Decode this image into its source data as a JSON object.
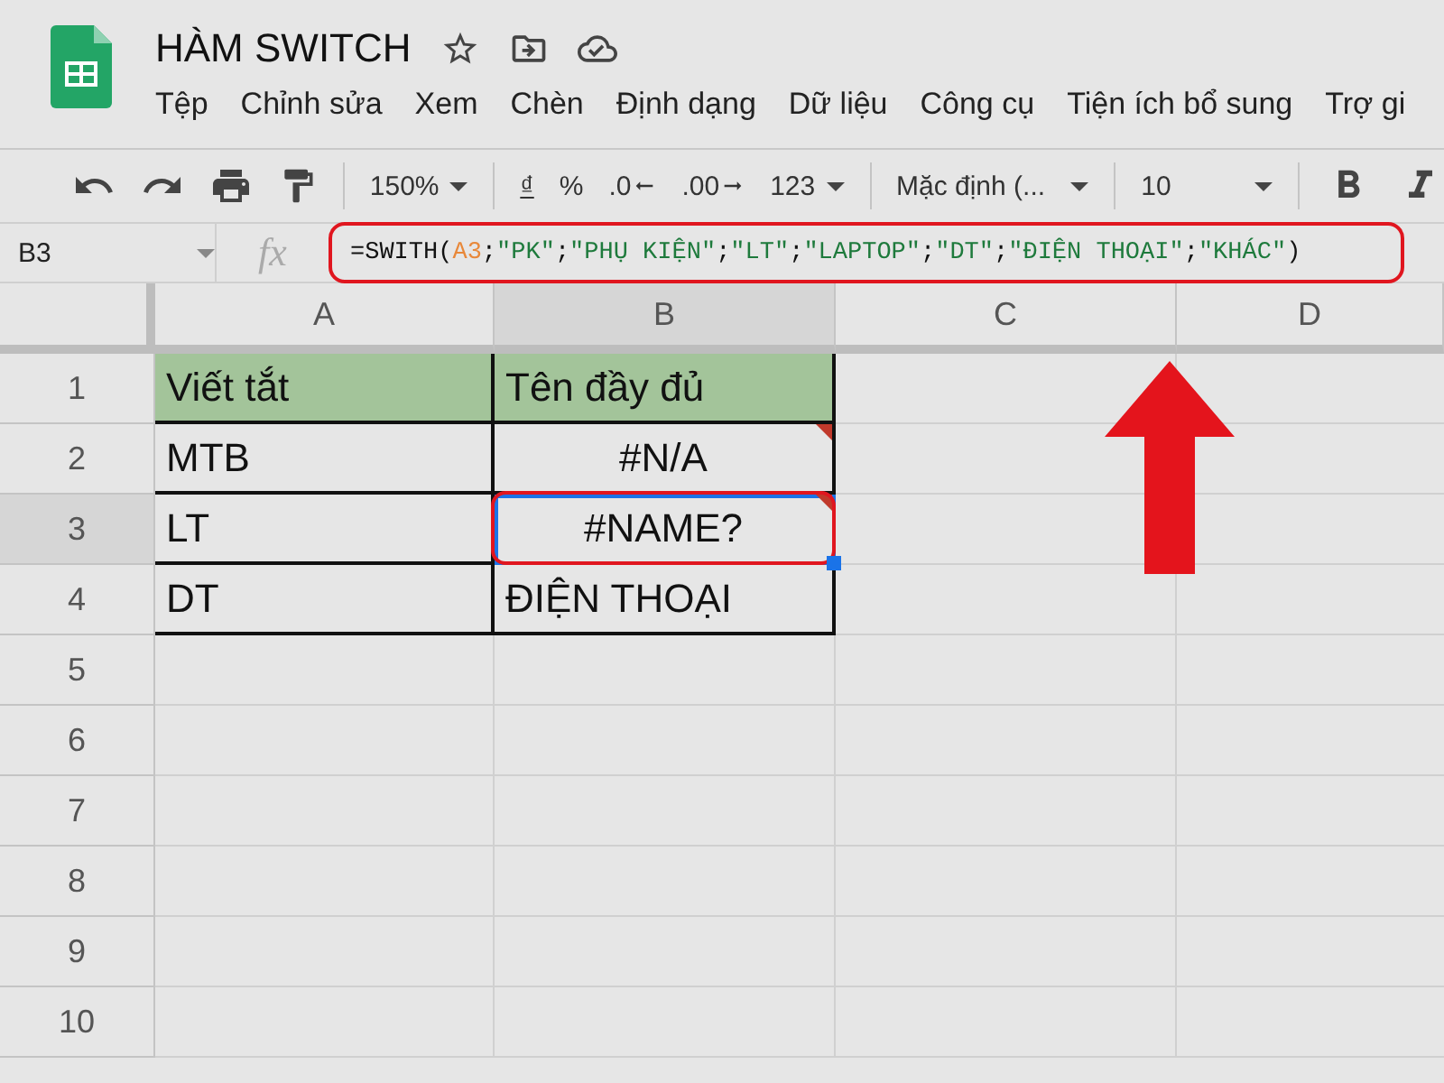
{
  "document": {
    "title": "HÀM SWITCH"
  },
  "menu": [
    "Tệp",
    "Chỉnh sửa",
    "Xem",
    "Chèn",
    "Định dạng",
    "Dữ liệu",
    "Công cụ",
    "Tiện ích bổ sung",
    "Trợ gi"
  ],
  "toolbar": {
    "zoom": "150%",
    "currency": "₫",
    "percent": "%",
    "decrease_decimals": ".0",
    "increase_decimals": ".00",
    "more_formats": "123",
    "font": "Mặc định (...",
    "font_size": "10"
  },
  "formula_bar": {
    "name_box": "B3",
    "fx_label": "fx",
    "highlighted": true,
    "tokens": [
      {
        "kind": "text",
        "text": "=SWITH("
      },
      {
        "kind": "ref",
        "text": "A3"
      },
      {
        "kind": "text",
        "text": ";"
      },
      {
        "kind": "string",
        "text": "\"PK\""
      },
      {
        "kind": "text",
        "text": ";"
      },
      {
        "kind": "string",
        "text": "\"PHỤ KIỆN\""
      },
      {
        "kind": "text",
        "text": ";"
      },
      {
        "kind": "string",
        "text": "\"LT\""
      },
      {
        "kind": "text",
        "text": ";"
      },
      {
        "kind": "string",
        "text": "\"LAPTOP\""
      },
      {
        "kind": "text",
        "text": ";"
      },
      {
        "kind": "string",
        "text": "\"DT\""
      },
      {
        "kind": "text",
        "text": ";"
      },
      {
        "kind": "string",
        "text": "\"ĐIỆN THOẠI\""
      },
      {
        "kind": "text",
        "text": ";"
      },
      {
        "kind": "string",
        "text": "\"KHÁC\""
      },
      {
        "kind": "text",
        "text": ")"
      }
    ]
  },
  "callout_arrow": true,
  "sheet": {
    "columns": [
      {
        "label": "A",
        "selected": false
      },
      {
        "label": "B",
        "selected": true
      },
      {
        "label": "C",
        "selected": false
      },
      {
        "label": "D",
        "selected": false
      }
    ],
    "rows": [
      {
        "label": "1",
        "selected": false,
        "cells": [
          {
            "text": "Viết tắt",
            "header": true,
            "centered": false,
            "error": false,
            "selected": false,
            "highlighted": false
          },
          {
            "text": "Tên đầy đủ",
            "header": true,
            "centered": false,
            "error": false,
            "selected": false,
            "highlighted": false
          }
        ]
      },
      {
        "label": "2",
        "selected": false,
        "cells": [
          {
            "text": "MTB",
            "header": false,
            "centered": false,
            "error": false,
            "selected": false,
            "highlighted": false
          },
          {
            "text": "#N/A",
            "header": false,
            "centered": true,
            "error": true,
            "selected": false,
            "highlighted": false
          }
        ]
      },
      {
        "label": "3",
        "selected": true,
        "cells": [
          {
            "text": "LT",
            "header": false,
            "centered": false,
            "error": false,
            "selected": false,
            "highlighted": false
          },
          {
            "text": "#NAME?",
            "header": false,
            "centered": true,
            "error": true,
            "selected": true,
            "highlighted": true
          }
        ]
      },
      {
        "label": "4",
        "selected": false,
        "cells": [
          {
            "text": "DT",
            "header": false,
            "centered": false,
            "error": false,
            "selected": false,
            "highlighted": false
          },
          {
            "text": "ĐIỆN THOẠI",
            "header": false,
            "centered": false,
            "error": false,
            "selected": false,
            "highlighted": false
          }
        ]
      },
      {
        "label": "5",
        "selected": false,
        "cells": []
      },
      {
        "label": "6",
        "selected": false,
        "cells": []
      },
      {
        "label": "7",
        "selected": false,
        "cells": []
      },
      {
        "label": "8",
        "selected": false,
        "cells": []
      },
      {
        "label": "9",
        "selected": false,
        "cells": []
      },
      {
        "label": "10",
        "selected": false,
        "cells": []
      }
    ]
  }
}
